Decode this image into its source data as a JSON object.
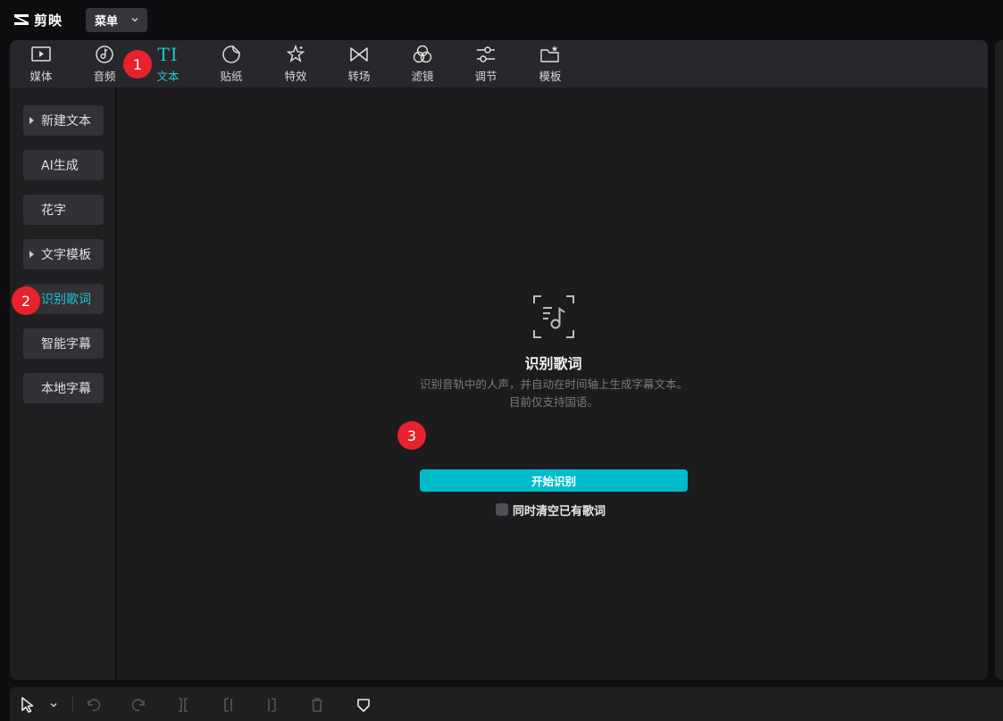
{
  "app": {
    "name": "剪映",
    "menu_label": "菜单"
  },
  "toolbar": {
    "tabs": [
      {
        "label": "媒体",
        "icon": "media-icon"
      },
      {
        "label": "音频",
        "icon": "audio-icon"
      },
      {
        "label": "文本",
        "icon": "text-icon",
        "active": true
      },
      {
        "label": "贴纸",
        "icon": "sticker-icon"
      },
      {
        "label": "特效",
        "icon": "effects-icon"
      },
      {
        "label": "转场",
        "icon": "transition-icon"
      },
      {
        "label": "滤镜",
        "icon": "filter-icon"
      },
      {
        "label": "调节",
        "icon": "adjust-icon"
      },
      {
        "label": "模板",
        "icon": "template-icon"
      }
    ],
    "text_icon_glyph": "TI"
  },
  "sidebar": {
    "items": [
      {
        "label": "新建文本",
        "caret": true
      },
      {
        "label": "AI生成"
      },
      {
        "label": "花字"
      },
      {
        "label": "文字模板",
        "caret": true
      },
      {
        "label": "识别歌词",
        "active": true
      },
      {
        "label": "智能字幕"
      },
      {
        "label": "本地字幕"
      }
    ]
  },
  "content": {
    "title": "识别歌词",
    "description": "识别音轨中的人声，并自动在时间轴上生成字幕文本。目前仅支持国语。",
    "start_button": "开始识别",
    "clear_checkbox_label": "同时清空已有歌词",
    "clear_checkbox_checked": false
  },
  "markers": [
    "1",
    "2",
    "3"
  ],
  "colors": {
    "accent": "#22c5d2",
    "button": "#00bcc9",
    "marker": "#e8222d"
  }
}
